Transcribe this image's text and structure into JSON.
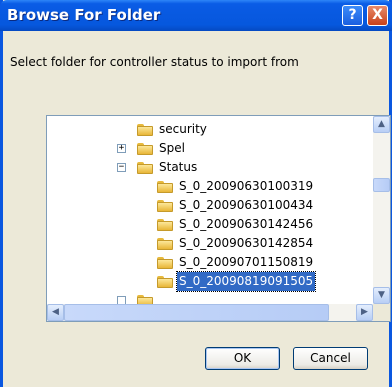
{
  "window": {
    "title": "Browse For Folder",
    "help_glyph": "?",
    "close_glyph": "X"
  },
  "prompt": "Select folder for controller status to import from",
  "tree": {
    "items": [
      {
        "label": "security",
        "expander": "",
        "selected": false
      },
      {
        "label": "Spel",
        "expander": "+",
        "selected": false
      },
      {
        "label": "Status",
        "expander": "−",
        "selected": false
      },
      {
        "label": "S_0_20090630100319",
        "expander": "",
        "selected": false
      },
      {
        "label": "S_0_20090630100434",
        "expander": "",
        "selected": false
      },
      {
        "label": "S_0_20090630142456",
        "expander": "",
        "selected": false
      },
      {
        "label": "S_0_20090630142854",
        "expander": "",
        "selected": false
      },
      {
        "label": "S_0_20090701150819",
        "expander": "",
        "selected": false
      },
      {
        "label": "S_0_20090819091505",
        "expander": "",
        "selected": true
      }
    ],
    "scroll_up": "▲",
    "scroll_down": "▼",
    "scroll_left": "◀",
    "scroll_right": "▶"
  },
  "buttons": {
    "ok": "OK",
    "cancel": "Cancel"
  },
  "colors": {
    "title_bar": "#0A5CE6",
    "selection": "#316AC5",
    "dialog_bg": "#ECE9D8"
  }
}
